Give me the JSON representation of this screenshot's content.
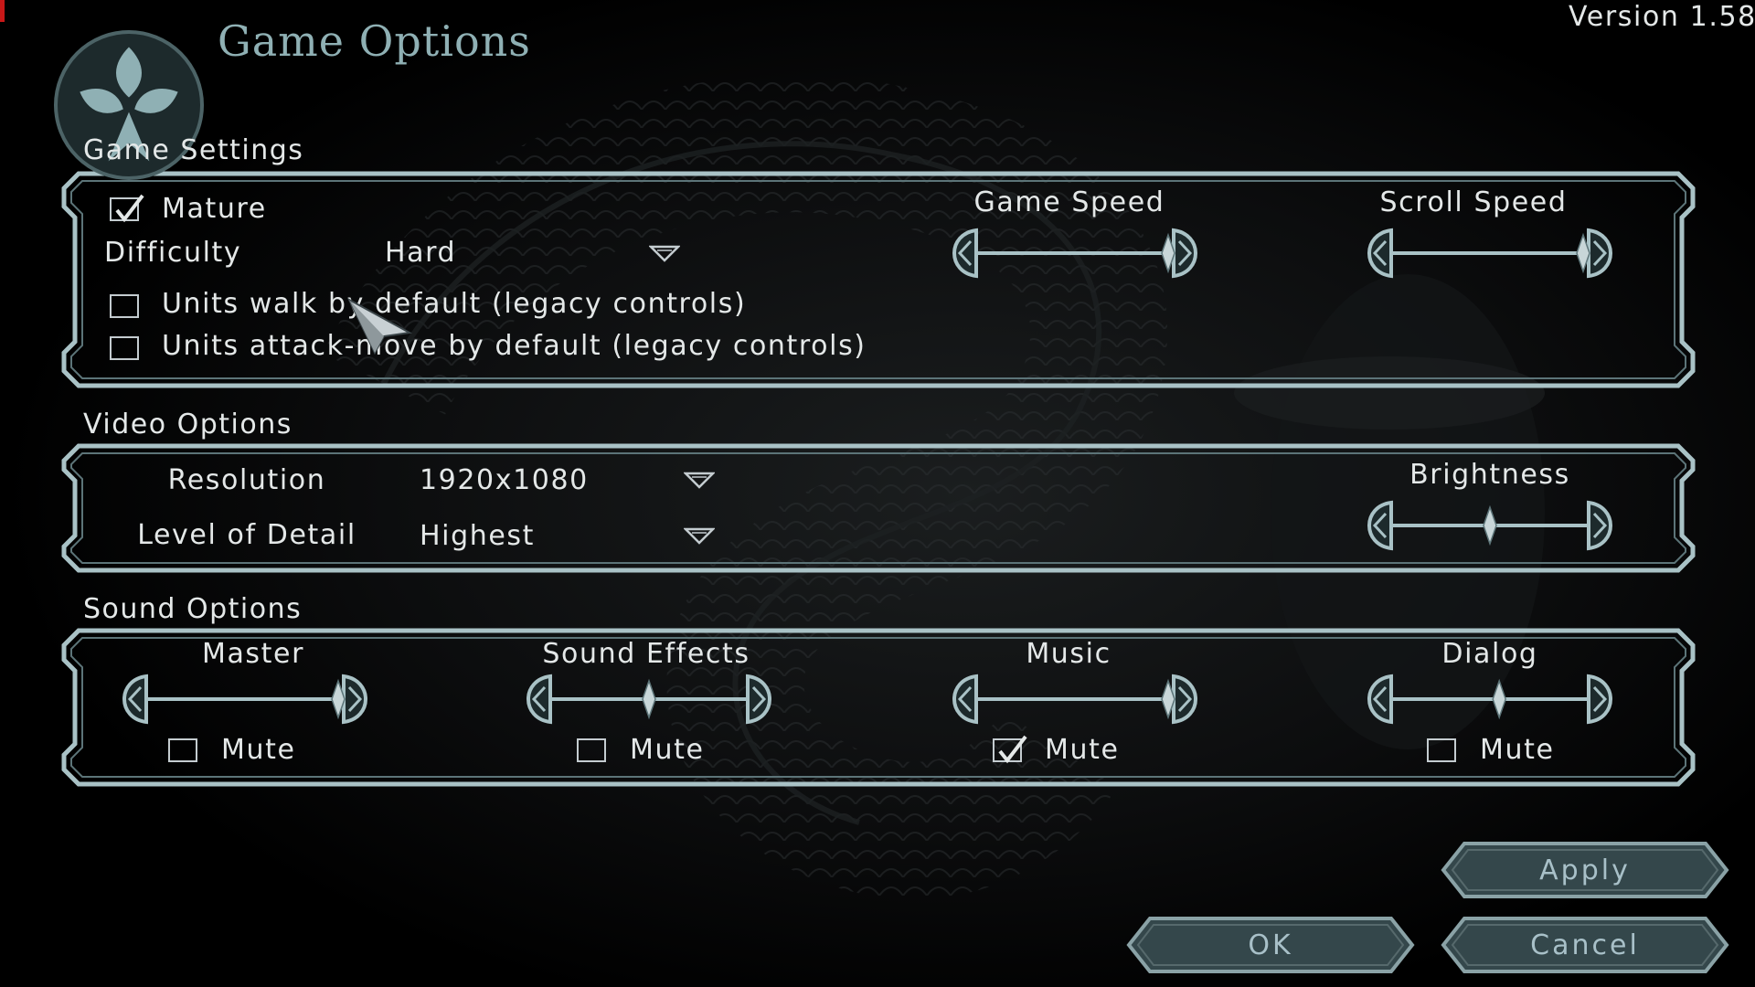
{
  "title": "Game Options",
  "version": "Version 1.58",
  "colors": {
    "accent": "#8fb0b4",
    "frame": "#a9c2c6",
    "text": "#e4e8e8",
    "background": "#000000"
  },
  "logo_icon": "clan-crest-icon",
  "game_settings": {
    "label": "Game Settings",
    "mature": {
      "label": "Mature",
      "checked": true
    },
    "difficulty": {
      "label": "Difficulty",
      "value": "Hard"
    },
    "walk_default": {
      "label": "Units walk by default (legacy controls)",
      "checked": false
    },
    "attack_move_default": {
      "label": "Units attack-move by default (legacy controls)",
      "checked": false
    },
    "game_speed": {
      "label": "Game Speed",
      "value": 1.0
    },
    "scroll_speed": {
      "label": "Scroll Speed",
      "value": 1.0
    }
  },
  "video_options": {
    "label": "Video Options",
    "resolution": {
      "label": "Resolution",
      "value": "1920x1080"
    },
    "level_of_detail": {
      "label": "Level of Detail",
      "value": "Highest"
    },
    "brightness": {
      "label": "Brightness",
      "value": 0.5
    }
  },
  "sound_options": {
    "label": "Sound Options",
    "channels": [
      {
        "label": "Master",
        "value": 1.0,
        "mute_label": "Mute",
        "muted": false
      },
      {
        "label": "Sound Effects",
        "value": 0.5,
        "mute_label": "Mute",
        "muted": false
      },
      {
        "label": "Music",
        "value": 1.0,
        "mute_label": "Mute",
        "muted": true
      },
      {
        "label": "Dialog",
        "value": 0.55,
        "mute_label": "Mute",
        "muted": false
      }
    ]
  },
  "buttons": {
    "apply": "Apply",
    "ok": "OK",
    "cancel": "Cancel"
  }
}
